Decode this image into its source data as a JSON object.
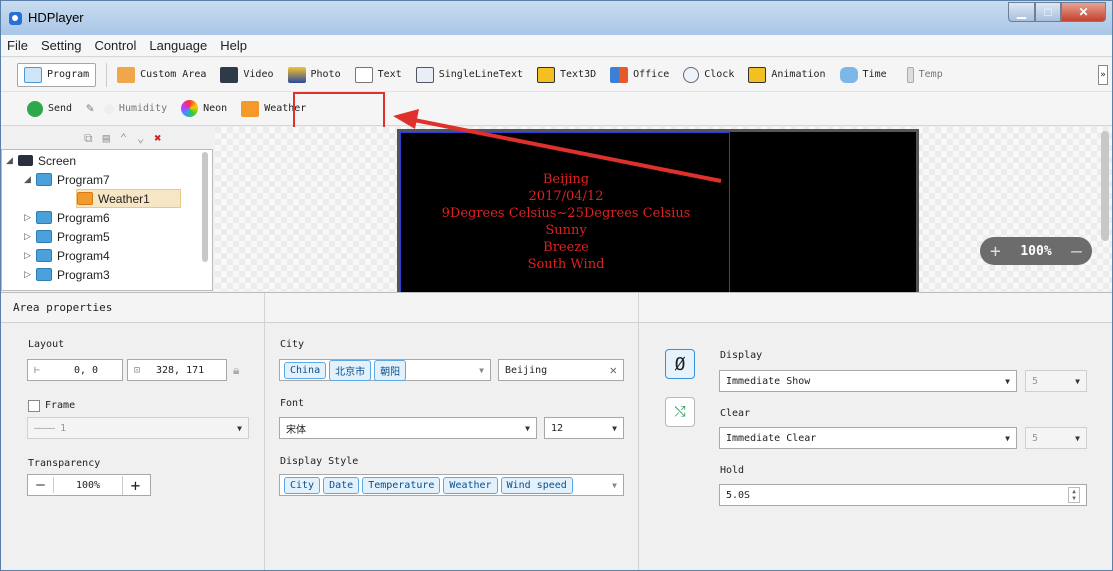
{
  "window": {
    "title": "HDPlayer"
  },
  "menu": [
    "File",
    "Setting",
    "Control",
    "Language",
    "Help"
  ],
  "toolbar": {
    "row1": [
      {
        "label": "Program",
        "icon": "program-icon"
      },
      {
        "label": "Custom Area",
        "icon": "custom-area-icon"
      },
      {
        "label": "Video",
        "icon": "video-icon"
      },
      {
        "label": "Photo",
        "icon": "photo-icon"
      },
      {
        "label": "Text",
        "icon": "text-icon"
      },
      {
        "label": "SingleLineText",
        "icon": "single-line-text-icon"
      },
      {
        "label": "Text3D",
        "icon": "text3d-icon"
      },
      {
        "label": "Office",
        "icon": "office-icon"
      },
      {
        "label": "Clock",
        "icon": "clock-icon"
      },
      {
        "label": "Animation",
        "icon": "animation-icon"
      },
      {
        "label": "Time",
        "icon": "time-icon"
      },
      {
        "label": "Temp",
        "icon": "temp-icon"
      }
    ],
    "row2": [
      {
        "label": "Send",
        "icon": "send-icon"
      },
      {
        "label": "Humidity",
        "icon": "humidity-icon"
      },
      {
        "label": "Neon",
        "icon": "neon-icon"
      },
      {
        "label": "Weather",
        "icon": "weather-icon"
      }
    ],
    "overflow": "»"
  },
  "tree": {
    "screen": "Screen",
    "program7": "Program7",
    "weather1": "Weather1",
    "program6": "Program6",
    "program5": "Program5",
    "program4": "Program4",
    "program3": "Program3"
  },
  "preview": {
    "lines": [
      "Beijing",
      "2017/04/12",
      "9Degrees Celsius~25Degrees Celsius",
      "Sunny",
      "Breeze",
      "South Wind"
    ],
    "zoom": "100%"
  },
  "properties": {
    "header": "Area properties",
    "layout": {
      "label": "Layout",
      "position": "0, 0",
      "size": "328, 171"
    },
    "frame": {
      "label": "Frame",
      "value": "1"
    },
    "transparency": {
      "label": "Transparency",
      "value": "100%"
    },
    "city": {
      "label": "City",
      "chips": [
        "China",
        "北京市",
        "朝阳"
      ],
      "value": "Beijing"
    },
    "font": {
      "label": "Font",
      "family": "宋体",
      "size": "12"
    },
    "display_style": {
      "label": "Display Style",
      "chips": [
        "City",
        "Date",
        "Temperature",
        "Weather",
        "Wind speed"
      ]
    },
    "display": {
      "label": "Display",
      "value": "Immediate Show",
      "speed": "5"
    },
    "clear": {
      "label": "Clear",
      "value": "Immediate Clear",
      "speed": "5"
    },
    "hold": {
      "label": "Hold",
      "value": "5.0S"
    }
  },
  "colors": {
    "highlight": "#e0302c",
    "screen_text": "#e02020"
  }
}
